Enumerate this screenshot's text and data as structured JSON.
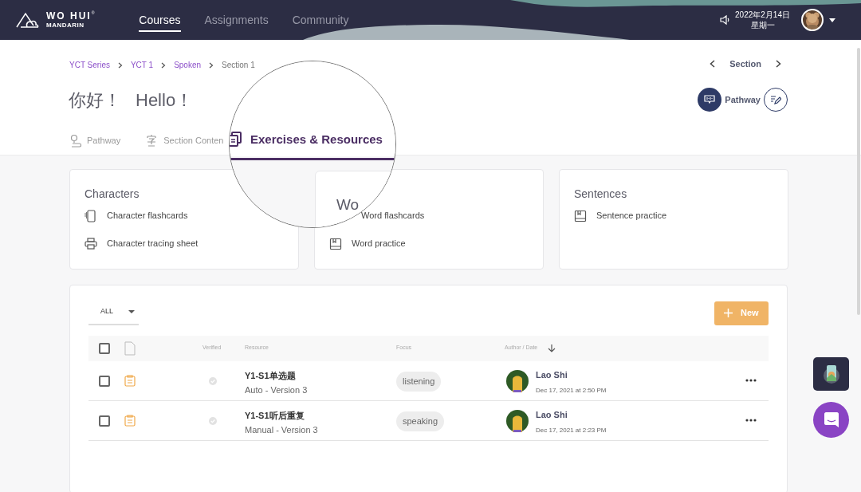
{
  "brand": {
    "name": "WO HUI",
    "sub": "MANDARIN",
    "mark": "®"
  },
  "nav": [
    {
      "label": "Courses",
      "selected": true
    },
    {
      "label": "Assignments",
      "selected": false
    },
    {
      "label": "Community",
      "selected": false
    }
  ],
  "date": "2022年2月14日",
  "weekday": "星期一",
  "breadcrumb": [
    "YCT Series",
    "YCT 1",
    "Spoken",
    "Section 1"
  ],
  "section_nav": "Section",
  "title": [
    "你好！",
    "Hello！"
  ],
  "pathway_label": "Pathway",
  "tabs": [
    {
      "label": "Pathway",
      "kind": "pin",
      "selected": false
    },
    {
      "label": "Section Conten",
      "kind": "char",
      "selected": false
    },
    {
      "label": "Exercises & Resources",
      "kind": "docs",
      "selected": true
    }
  ],
  "cards": [
    {
      "title": "Characters",
      "items": [
        {
          "label": "Character flashcards",
          "kind": "flashcard"
        },
        {
          "label": "Character tracing sheet",
          "kind": "printer"
        }
      ]
    },
    {
      "title": "Wo",
      "items": [
        {
          "label": "Word flashcards"
        },
        {
          "label": "Word practice",
          "kind": "book"
        }
      ]
    },
    {
      "title": "Sentences",
      "items": [
        {
          "label": "Sentence practice",
          "kind": "book"
        }
      ]
    }
  ],
  "filter": "ALL",
  "new_button": "New",
  "select_all": {
    "checked": false
  },
  "columns": [
    "Verified",
    "Resource",
    "Focus",
    "Author / Date"
  ],
  "rows": [
    {
      "checked": false,
      "title": "Y1-S1单选题",
      "subtitle": "Auto - Version 3",
      "focus": "listening",
      "author": "Lao Shi",
      "date": "Dec 17, 2021 at 2:50 PM"
    },
    {
      "checked": false,
      "title": "Y1-S1听后重复",
      "subtitle": "Manual - Version 3",
      "focus": "speaking",
      "author": "Lao Shi",
      "date": "Dec 17, 2021 at 2:23 PM"
    }
  ]
}
